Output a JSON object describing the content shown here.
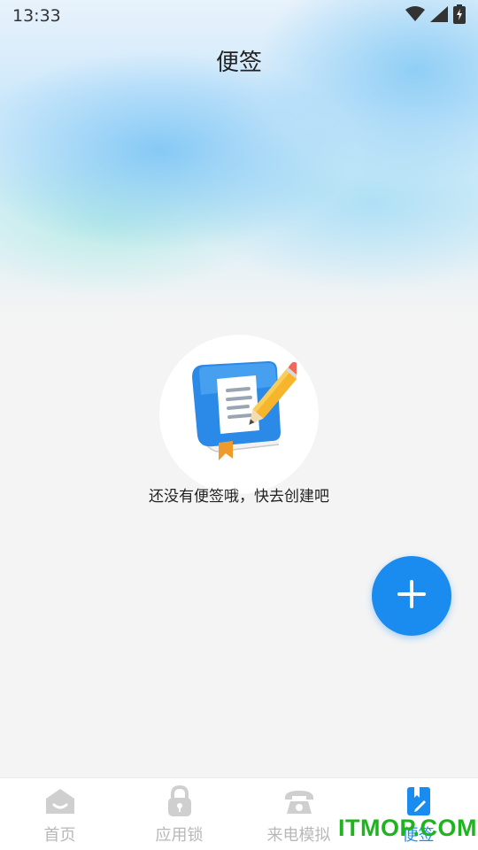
{
  "status_bar": {
    "time": "13:33",
    "icons": [
      "wifi-icon",
      "signal-icon",
      "battery-charging-icon"
    ]
  },
  "page": {
    "title": "便签"
  },
  "empty_state": {
    "icon": "notebook-pencil-icon",
    "message": "还没有便签哦，快去创建吧"
  },
  "fab": {
    "icon": "plus-icon",
    "color": "#1a8cf0"
  },
  "bottom_nav": {
    "items": [
      {
        "label": "首页",
        "icon": "home-icon",
        "active": false
      },
      {
        "label": "应用锁",
        "icon": "lock-icon",
        "active": false
      },
      {
        "label": "来电模拟",
        "icon": "phone-icon",
        "active": false
      },
      {
        "label": "便签",
        "icon": "note-icon",
        "active": true
      }
    ],
    "active_color": "#1a8cf0",
    "inactive_color": "#b8b8b8"
  },
  "watermark": {
    "text": "ITMOP.COM",
    "color": "#1fb41f"
  }
}
